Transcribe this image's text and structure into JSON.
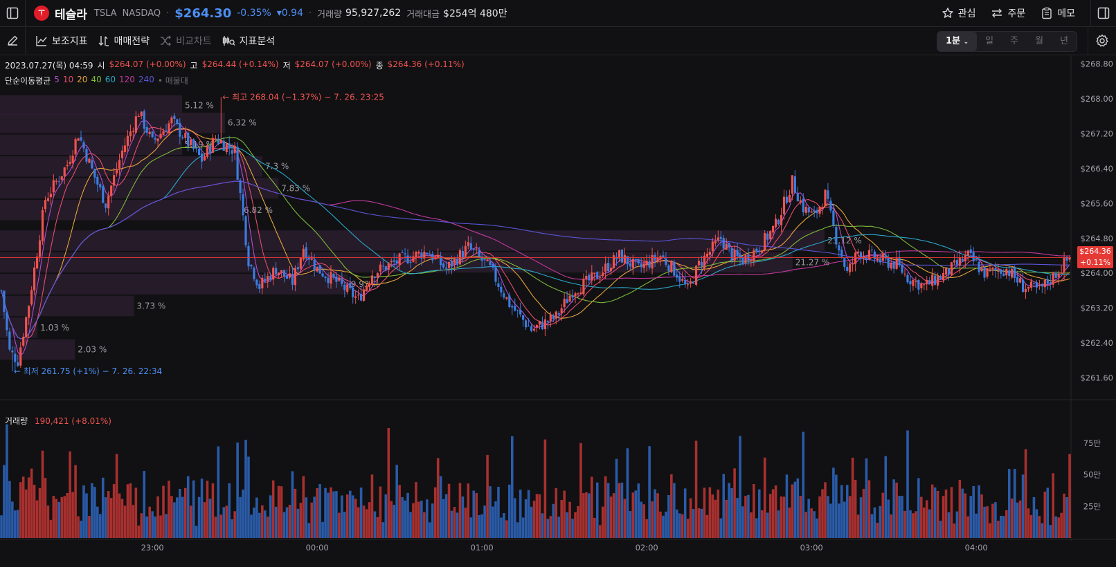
{
  "header": {
    "name": "테슬라",
    "ticker": "TSLA",
    "exchange": "NASDAQ",
    "price": "$264.30",
    "change_pct": "-0.35%",
    "change": "▾0.94",
    "volume_label": "거래량",
    "volume": "95,927,262",
    "amount_label": "거래대금",
    "amount": "$254억 480만",
    "actions": [
      "관심",
      "주문",
      "메모"
    ]
  },
  "toolbar": {
    "items": [
      "보조지표",
      "매매전략",
      "비교차트",
      "지표분석"
    ],
    "periods": [
      "1분",
      "일",
      "주",
      "월",
      "년"
    ],
    "selected_period": "1분"
  },
  "ohlc": {
    "date": "2023.07.27(목) 04:59",
    "open_label": "시",
    "open": "$264.07 (+0.00%)",
    "high_label": "고",
    "high": "$264.44 (+0.14%)",
    "low_label": "저",
    "low": "$264.07 (+0.00%)",
    "close_label": "종",
    "close": "$264.36 (+0.11%)"
  },
  "ma_legend": {
    "label": "단순이동평균",
    "periods": [
      {
        "n": "5",
        "color": "#b34dd1"
      },
      {
        "n": "10",
        "color": "#e84c6d"
      },
      {
        "n": "20",
        "color": "#e8a33c"
      },
      {
        "n": "40",
        "color": "#7dbb3a"
      },
      {
        "n": "60",
        "color": "#29a7c9"
      },
      {
        "n": "120",
        "color": "#c2399e"
      },
      {
        "n": "240",
        "color": "#5a55d8"
      }
    ],
    "extra": "• 매물대"
  },
  "colors": {
    "up": "#ef5350",
    "down": "#3b7de0",
    "up_vol": "#a8302f",
    "down_vol": "#2a5ba8",
    "price_line": "#e53935"
  },
  "current_tag": {
    "price": "$264.36",
    "pct": "+0.11%",
    "value": 264.36
  },
  "volume_header": {
    "label": "거래량",
    "value": "190,421 (+8.01%)"
  },
  "chart_data": {
    "type": "candlestick",
    "title": "TSLA 1분",
    "y_ticks": [
      268.8,
      268.0,
      267.2,
      266.4,
      265.6,
      264.8,
      264.0,
      263.2,
      262.4,
      261.6
    ],
    "y_tick_labels": [
      "$268.80",
      "$268.00",
      "$267.20",
      "$266.40",
      "$265.60",
      "$264.80",
      "$264.00",
      "$263.20",
      "$262.40",
      "$261.60"
    ],
    "ylim": [
      261.1,
      269.0
    ],
    "x_ticks": [
      "23:00",
      "00:00",
      "01:00",
      "02:00",
      "03:00",
      "04:00"
    ],
    "x_tick_minutes": [
      55,
      115,
      175,
      235,
      295,
      355
    ],
    "n_bars": 390,
    "annotations": {
      "high": {
        "text": "← 최고 268.04 (−1.37%) − 7. 26. 23:25",
        "value": 268.04,
        "minute": 80
      },
      "low": {
        "text": "← 최저 261.75 (+1%) − 7. 26. 22:34",
        "value": 261.75,
        "minute": 4
      }
    },
    "close_anchors": [
      [
        0,
        263.6
      ],
      [
        3,
        262.2
      ],
      [
        6,
        262.0
      ],
      [
        10,
        263.3
      ],
      [
        16,
        265.7
      ],
      [
        24,
        266.5
      ],
      [
        28,
        267.2
      ],
      [
        34,
        266.2
      ],
      [
        38,
        265.6
      ],
      [
        44,
        266.8
      ],
      [
        50,
        267.7
      ],
      [
        55,
        267.0
      ],
      [
        62,
        267.5
      ],
      [
        68,
        267.0
      ],
      [
        73,
        266.6
      ],
      [
        78,
        267.1
      ],
      [
        85,
        266.8
      ],
      [
        90,
        264.3
      ],
      [
        94,
        263.7
      ],
      [
        100,
        264.1
      ],
      [
        106,
        263.8
      ],
      [
        110,
        264.6
      ],
      [
        115,
        264.1
      ],
      [
        122,
        263.8
      ],
      [
        130,
        263.4
      ],
      [
        135,
        264.0
      ],
      [
        145,
        264.3
      ],
      [
        155,
        264.5
      ],
      [
        162,
        264.1
      ],
      [
        170,
        264.6
      ],
      [
        178,
        264.1
      ],
      [
        185,
        263.3
      ],
      [
        193,
        262.7
      ],
      [
        202,
        263.0
      ],
      [
        208,
        263.6
      ],
      [
        216,
        263.9
      ],
      [
        225,
        264.4
      ],
      [
        232,
        264.1
      ],
      [
        240,
        264.4
      ],
      [
        246,
        264.0
      ],
      [
        250,
        263.6
      ],
      [
        254,
        264.2
      ],
      [
        262,
        264.8
      ],
      [
        266,
        264.4
      ],
      [
        270,
        264.3
      ],
      [
        276,
        264.6
      ],
      [
        282,
        265.1
      ],
      [
        288,
        266.1
      ],
      [
        292,
        265.5
      ],
      [
        296,
        265.3
      ],
      [
        300,
        265.8
      ],
      [
        304,
        264.8
      ],
      [
        308,
        264.0
      ],
      [
        312,
        264.5
      ],
      [
        320,
        264.3
      ],
      [
        326,
        264.2
      ],
      [
        330,
        263.9
      ],
      [
        336,
        263.7
      ],
      [
        344,
        264.0
      ],
      [
        352,
        264.4
      ],
      [
        358,
        264.0
      ],
      [
        366,
        264.1
      ],
      [
        372,
        263.7
      ],
      [
        378,
        263.6
      ],
      [
        384,
        264.0
      ],
      [
        389,
        264.36
      ]
    ],
    "volume_y_ticks": [
      75,
      50,
      25
    ],
    "volume_y_labels": [
      "75만",
      "50만",
      "25만"
    ],
    "volume_ylim": [
      0,
      92
    ],
    "volume_profile": [
      {
        "price": 267.85,
        "pct": "5.12 %",
        "width": 0.17
      },
      {
        "price": 267.45,
        "pct": "6.32 %",
        "width": 0.21
      },
      {
        "price": 266.95,
        "pct": "5.19 %",
        "width": 0.17
      },
      {
        "price": 266.45,
        "pct": "7.3 %",
        "width": 0.245
      },
      {
        "price": 265.95,
        "pct": "7.83 %",
        "width": 0.26
      },
      {
        "price": 265.45,
        "pct": "6.82 %",
        "width": 0.225
      },
      {
        "price": 264.75,
        "pct": "23.12 %",
        "width": 0.77
      },
      {
        "price": 264.25,
        "pct": "21.27 %",
        "width": 0.74
      },
      {
        "price": 263.75,
        "pct": "9.93 %",
        "width": 0.325
      },
      {
        "price": 263.25,
        "pct": "3.73 %",
        "width": 0.125
      },
      {
        "price": 262.75,
        "pct": "1.03 %",
        "width": 0.035
      },
      {
        "price": 262.25,
        "pct": "2.03 %",
        "width": 0.07
      }
    ]
  }
}
